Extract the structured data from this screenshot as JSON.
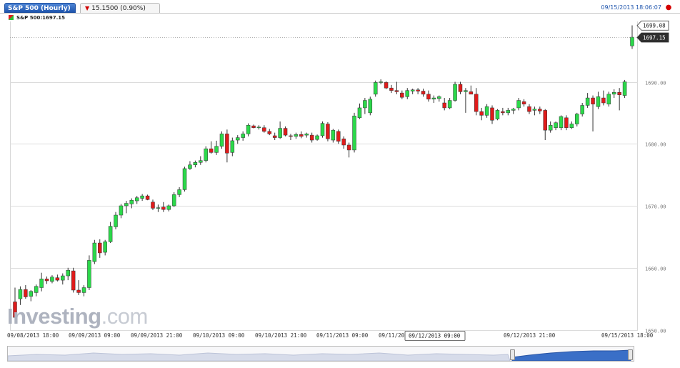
{
  "header": {
    "tab_title": "S&P 500 (Hourly)",
    "change_text": "15.1500 (0.90%)",
    "timestamp": "09/15/2013 18:06:07",
    "change_direction_icon": "down-triangle-icon",
    "settings_icon": "record-icon"
  },
  "legend": {
    "label": "S&P 500:1697.15"
  },
  "watermark": {
    "brand_bold": "Investing",
    "brand_light": ".com"
  },
  "colors": {
    "up": "#2bd94a",
    "down": "#e01b1b",
    "grid": "#dcdcdc",
    "navigator_fill": "#3a6fc7"
  },
  "chart_data": {
    "type": "candlestick",
    "title": "S&P 500 (Hourly)",
    "ylim": [
      1650,
      1700
    ],
    "y_ticks": [
      1650,
      1660,
      1670,
      1680,
      1690
    ],
    "y_tick_labels": [
      "1650.00",
      "1660.00",
      "1670.00",
      "1680.00",
      "1690.00"
    ],
    "x_tick_labels": [
      "09/08/2013 18:00",
      "09/09/2013 09:00",
      "09/09/2013 21:00",
      "09/10/2013 09:00",
      "09/10/2013 21:00",
      "09/11/2013 09:00",
      "09/11/20",
      "09/12/2013 09:00",
      "09/12/2013 21:00",
      "09/15/2013 18:00"
    ],
    "crosshair_label": "09/12/2013 09:00",
    "price_tags": [
      {
        "label": "1699.08",
        "value": 1699.08,
        "style": "outline"
      },
      {
        "label": "1697.15",
        "value": 1697.15,
        "style": "filled"
      }
    ],
    "candles": [
      [
        1654.5,
        1656.8,
        1651.5,
        1652.0
      ],
      [
        1655.0,
        1657.0,
        1654.0,
        1656.5
      ],
      [
        1656.5,
        1657.2,
        1655.0,
        1655.3
      ],
      [
        1655.4,
        1656.4,
        1654.6,
        1656.2
      ],
      [
        1656.0,
        1657.3,
        1655.4,
        1657.0
      ],
      [
        1656.8,
        1659.2,
        1656.2,
        1658.2
      ],
      [
        1658.2,
        1658.6,
        1657.4,
        1657.9
      ],
      [
        1657.8,
        1658.8,
        1657.5,
        1658.5
      ],
      [
        1658.4,
        1658.9,
        1657.8,
        1658.0
      ],
      [
        1658.0,
        1659.1,
        1657.3,
        1658.7
      ],
      [
        1658.7,
        1660.0,
        1658.0,
        1659.6
      ],
      [
        1659.5,
        1660.0,
        1656.0,
        1656.4
      ],
      [
        1656.4,
        1658.0,
        1655.6,
        1656.0
      ],
      [
        1656.0,
        1657.2,
        1655.4,
        1656.8
      ],
      [
        1656.8,
        1662.0,
        1656.4,
        1661.2
      ],
      [
        1661.0,
        1664.5,
        1660.6,
        1664.0
      ],
      [
        1664.0,
        1664.6,
        1661.6,
        1662.4
      ],
      [
        1662.5,
        1664.5,
        1662.0,
        1664.2
      ],
      [
        1664.2,
        1667.4,
        1664.0,
        1666.7
      ],
      [
        1666.6,
        1669.0,
        1666.2,
        1668.5
      ],
      [
        1668.5,
        1670.3,
        1668.0,
        1670.0
      ],
      [
        1670.0,
        1670.8,
        1668.8,
        1670.4
      ],
      [
        1670.3,
        1671.2,
        1669.6,
        1670.9
      ],
      [
        1670.8,
        1671.6,
        1670.3,
        1671.3
      ],
      [
        1671.2,
        1671.9,
        1670.8,
        1671.6
      ],
      [
        1671.6,
        1671.8,
        1670.9,
        1671.0
      ],
      [
        1670.6,
        1671.0,
        1669.3,
        1669.6
      ],
      [
        1669.6,
        1670.2,
        1669.0,
        1669.7
      ],
      [
        1669.8,
        1670.6,
        1669.0,
        1669.4
      ],
      [
        1669.4,
        1670.2,
        1669.1,
        1670.0
      ],
      [
        1670.0,
        1672.2,
        1669.8,
        1671.8
      ],
      [
        1671.8,
        1673.0,
        1671.4,
        1672.6
      ],
      [
        1672.6,
        1676.3,
        1672.3,
        1676.0
      ],
      [
        1676.0,
        1677.2,
        1675.8,
        1676.6
      ],
      [
        1676.6,
        1677.3,
        1676.2,
        1677.0
      ],
      [
        1677.0,
        1678.0,
        1676.6,
        1677.3
      ],
      [
        1677.3,
        1679.6,
        1677.0,
        1679.2
      ],
      [
        1679.2,
        1680.4,
        1678.4,
        1678.6
      ],
      [
        1678.6,
        1680.5,
        1678.2,
        1679.6
      ],
      [
        1679.6,
        1682.0,
        1679.2,
        1681.6
      ],
      [
        1681.6,
        1682.3,
        1677.0,
        1678.5
      ],
      [
        1678.6,
        1681.0,
        1678.0,
        1680.5
      ],
      [
        1680.6,
        1681.4,
        1680.0,
        1681.0
      ],
      [
        1681.0,
        1682.0,
        1680.5,
        1681.6
      ],
      [
        1681.6,
        1683.3,
        1681.2,
        1683.0
      ],
      [
        1682.9,
        1683.1,
        1682.5,
        1682.6
      ],
      [
        1682.6,
        1683.0,
        1682.3,
        1682.7
      ],
      [
        1682.6,
        1683.0,
        1681.8,
        1682.0
      ],
      [
        1682.0,
        1682.4,
        1681.4,
        1681.6
      ],
      [
        1681.3,
        1681.8,
        1680.6,
        1681.0
      ],
      [
        1681.0,
        1683.6,
        1680.8,
        1682.5
      ],
      [
        1682.5,
        1682.8,
        1681.2,
        1681.4
      ],
      [
        1681.3,
        1681.6,
        1680.6,
        1681.2
      ],
      [
        1681.2,
        1681.8,
        1680.8,
        1681.5
      ],
      [
        1681.5,
        1682.0,
        1680.9,
        1681.2
      ],
      [
        1681.4,
        1681.8,
        1681.0,
        1681.6
      ],
      [
        1681.4,
        1681.8,
        1680.2,
        1680.6
      ],
      [
        1680.7,
        1681.5,
        1680.5,
        1681.3
      ],
      [
        1681.3,
        1683.6,
        1681.0,
        1683.3
      ],
      [
        1683.2,
        1683.5,
        1680.4,
        1680.8
      ],
      [
        1680.6,
        1682.4,
        1680.2,
        1682.2
      ],
      [
        1682.0,
        1682.3,
        1680.0,
        1680.4
      ],
      [
        1680.8,
        1681.2,
        1679.2,
        1679.8
      ],
      [
        1679.8,
        1680.2,
        1677.8,
        1679.0
      ],
      [
        1679.0,
        1685.0,
        1678.6,
        1684.5
      ],
      [
        1684.2,
        1686.5,
        1684.0,
        1685.8
      ],
      [
        1685.8,
        1687.4,
        1684.8,
        1687.0
      ],
      [
        1685.0,
        1687.6,
        1684.6,
        1687.2
      ],
      [
        1688.0,
        1690.2,
        1687.6,
        1689.9
      ],
      [
        1690.0,
        1690.4,
        1689.6,
        1690.0
      ],
      [
        1689.9,
        1690.1,
        1688.8,
        1689.0
      ],
      [
        1689.0,
        1689.5,
        1688.2,
        1688.6
      ],
      [
        1688.6,
        1690.0,
        1688.0,
        1688.4
      ],
      [
        1688.2,
        1688.6,
        1687.2,
        1687.5
      ],
      [
        1687.6,
        1689.0,
        1687.2,
        1688.6
      ],
      [
        1688.5,
        1688.9,
        1688.0,
        1688.7
      ],
      [
        1688.7,
        1689.0,
        1688.0,
        1688.5
      ],
      [
        1688.5,
        1688.9,
        1687.6,
        1688.0
      ],
      [
        1688.0,
        1688.6,
        1686.8,
        1687.2
      ],
      [
        1687.2,
        1687.8,
        1686.6,
        1687.4
      ],
      [
        1687.3,
        1687.8,
        1686.8,
        1687.6
      ],
      [
        1686.6,
        1687.4,
        1685.4,
        1685.8
      ],
      [
        1685.8,
        1687.4,
        1685.6,
        1687.0
      ],
      [
        1687.0,
        1690.0,
        1686.8,
        1689.6
      ],
      [
        1689.6,
        1690.0,
        1688.0,
        1688.4
      ],
      [
        1688.4,
        1689.0,
        1685.0,
        1688.6
      ],
      [
        1688.4,
        1689.4,
        1688.0,
        1688.0
      ],
      [
        1688.0,
        1689.0,
        1684.6,
        1685.2
      ],
      [
        1685.2,
        1685.8,
        1683.8,
        1684.6
      ],
      [
        1684.6,
        1686.4,
        1684.2,
        1686.0
      ],
      [
        1685.8,
        1686.2,
        1683.2,
        1683.8
      ],
      [
        1684.0,
        1685.6,
        1683.8,
        1685.4
      ],
      [
        1685.2,
        1685.8,
        1684.6,
        1685.0
      ],
      [
        1685.0,
        1685.8,
        1684.6,
        1685.4
      ],
      [
        1685.4,
        1685.8,
        1684.8,
        1685.6
      ],
      [
        1685.8,
        1687.4,
        1685.4,
        1687.0
      ],
      [
        1686.8,
        1687.2,
        1686.0,
        1686.4
      ],
      [
        1686.0,
        1686.4,
        1684.8,
        1685.2
      ],
      [
        1685.4,
        1686.0,
        1684.6,
        1685.6
      ],
      [
        1685.6,
        1686.0,
        1684.8,
        1685.3
      ],
      [
        1685.4,
        1685.6,
        1680.6,
        1682.2
      ],
      [
        1682.2,
        1683.6,
        1681.8,
        1683.0
      ],
      [
        1682.6,
        1683.6,
        1682.2,
        1683.4
      ],
      [
        1682.6,
        1684.6,
        1682.2,
        1684.4
      ],
      [
        1684.2,
        1684.6,
        1682.2,
        1682.6
      ],
      [
        1682.6,
        1683.6,
        1682.4,
        1683.2
      ],
      [
        1683.2,
        1685.0,
        1682.8,
        1684.8
      ],
      [
        1684.8,
        1686.6,
        1684.4,
        1686.2
      ],
      [
        1686.2,
        1688.2,
        1685.8,
        1687.4
      ],
      [
        1687.4,
        1687.8,
        1682.0,
        1686.4
      ],
      [
        1686.0,
        1688.4,
        1685.6,
        1687.6
      ],
      [
        1687.4,
        1688.6,
        1686.2,
        1686.6
      ],
      [
        1686.4,
        1688.4,
        1686.0,
        1688.0
      ],
      [
        1688.0,
        1688.8,
        1687.4,
        1688.3
      ],
      [
        1688.3,
        1689.0,
        1685.4,
        1687.9
      ],
      [
        1687.8,
        1690.3,
        1687.4,
        1690.0
      ],
      [
        1695.8,
        1699.1,
        1695.3,
        1697.2
      ]
    ]
  }
}
